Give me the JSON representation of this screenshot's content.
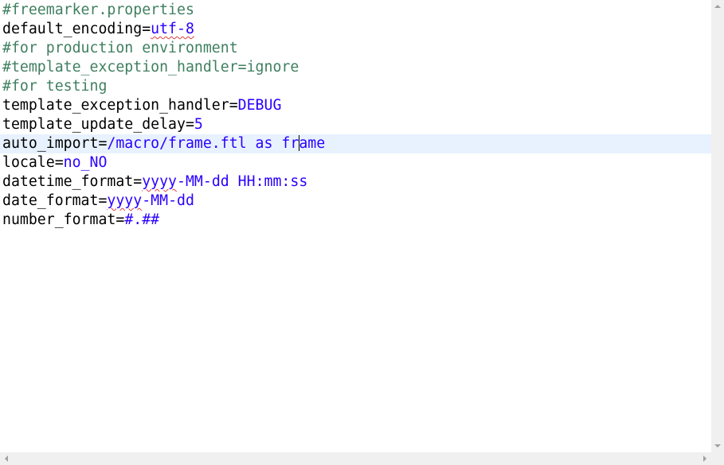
{
  "colors": {
    "comment": "#3f7f5f",
    "key": "#000000",
    "value": "#2a00ff",
    "current_line_highlight": "#e8f2fe",
    "spellcheck_underline": "#d94040",
    "scrollbar_track": "#f0f0f0"
  },
  "lines": [
    {
      "comment": "#freemarker.properties"
    },
    {
      "key": "default_encoding=",
      "value": "utf-8"
    },
    {
      "comment": "#for production environment"
    },
    {
      "comment": "#template_exception_handler=ignore"
    },
    {
      "comment": "#for testing"
    },
    {
      "key": "template_exception_handler=",
      "value": "DEBUG"
    },
    {
      "key": "template_update_delay=",
      "value": "5"
    },
    {
      "key": "auto_import=",
      "value_before_caret": "/macro/frame.ftl as fr",
      "value_after_caret": "ame"
    },
    {
      "key": "locale=",
      "value": "no_NO"
    },
    {
      "key": "datetime_format=",
      "value_spell": "yyyy",
      "value_rest": "-MM-dd HH:mm:ss"
    },
    {
      "key": "date_format=",
      "value_spell": "yyyy",
      "value_rest": "-MM-dd"
    },
    {
      "key": "number_format=",
      "value": "#.##"
    }
  ],
  "scrollbars": {
    "up_icon": "arrow-up",
    "down_icon": "arrow-down",
    "left_icon": "arrow-left",
    "right_icon": "arrow-right"
  }
}
